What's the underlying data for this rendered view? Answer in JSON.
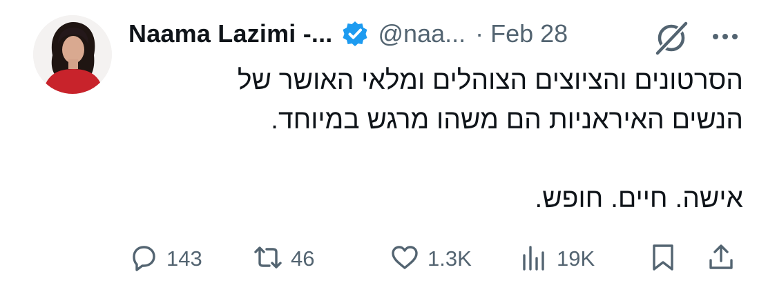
{
  "author": {
    "name": "Naama Lazimi -...",
    "handle": "@naa...",
    "separator": "·",
    "date": "Feb 28"
  },
  "tweet": {
    "lines": [
      "הסרטונים והציוצים הצוהלים ומלאי האושר של",
      "הנשים האיראניות הם משהו מרגש במיוחד.",
      "אישה. חיים. חופש."
    ]
  },
  "actions": {
    "replies": "143",
    "reposts": "46",
    "likes": "1.3K",
    "views": "19K"
  },
  "colors": {
    "verified": "#1d9bf0",
    "secondary_text": "#536471",
    "primary_text": "#0f1419"
  },
  "icons": [
    "verified-badge-icon",
    "grok-icon",
    "more-icon",
    "reply-icon",
    "repost-icon",
    "like-icon",
    "views-icon",
    "bookmark-icon",
    "share-icon"
  ]
}
